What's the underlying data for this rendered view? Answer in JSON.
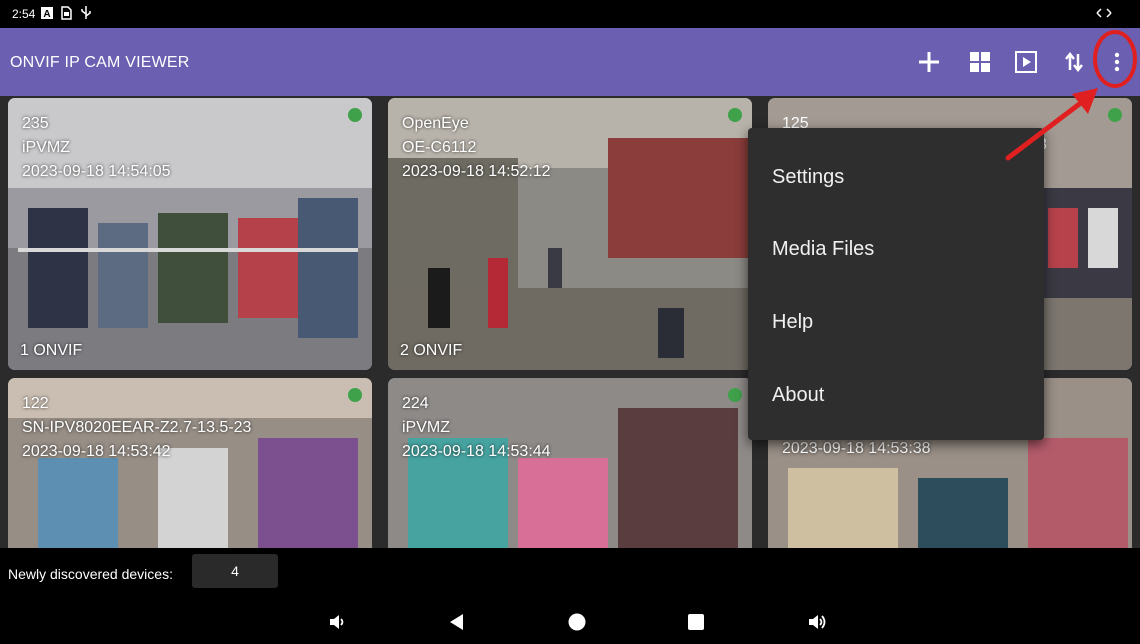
{
  "status_bar": {
    "time": "2:54",
    "icons": [
      "notification-a-icon",
      "sim-icon",
      "usb-icon",
      "data-transfer-icon"
    ]
  },
  "app_bar": {
    "title": "ONVIF IP CAM VIEWER",
    "actions": [
      "add-icon",
      "grid-layout-icon",
      "play-icon",
      "sort-icon",
      "more-vert-icon"
    ]
  },
  "cameras": [
    {
      "id": "235",
      "model": "iPVMZ",
      "timestamp": "2023-09-18 14:54:05",
      "label": "1 ONVIF",
      "selected": true
    },
    {
      "id": "OpenEye",
      "model": "OE-C6112",
      "timestamp": "2023-09-18 14:52:12",
      "label": "2 ONVIF",
      "selected": false
    },
    {
      "id": "125",
      "model": "3",
      "timestamp": "",
      "label": "",
      "selected": false
    },
    {
      "id": "122",
      "model": "SN-IPV8020EEAR-Z2.7-13.5-23",
      "timestamp": "2023-09-18 14:53:42",
      "label": "",
      "selected": false
    },
    {
      "id": "224",
      "model": "iPVMZ",
      "timestamp": "2023-09-18 14:53:44",
      "label": "",
      "selected": false
    },
    {
      "id": "",
      "model": "",
      "timestamp": "2023-09-18 14:53:38",
      "label": "",
      "selected": false
    }
  ],
  "overflow_menu": {
    "items": [
      "Settings",
      "Media Files",
      "Help",
      "About"
    ]
  },
  "bottom": {
    "newly_discovered_label": "Newly discovered devices:",
    "newly_discovered_count": "4"
  },
  "nav_bar": {
    "buttons": [
      "volume-down-icon",
      "back-icon",
      "home-icon",
      "recents-icon",
      "volume-up-icon"
    ]
  },
  "colors": {
    "app_bar": "#6a5fb0",
    "selected_border": "#3f86d8",
    "online_dot": "#3fa14a",
    "annotation": "#e02020"
  }
}
